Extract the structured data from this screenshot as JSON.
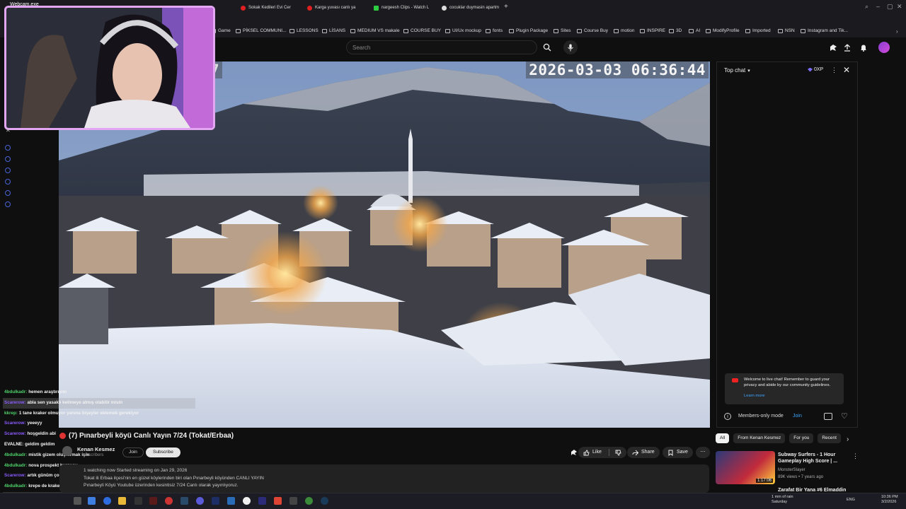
{
  "browser": {
    "tabs": [
      {
        "label": "Sokak Kedileri Evi Cer",
        "icon": "youtube-icon"
      },
      {
        "label": "Karga yuvası canlı ya",
        "icon": "youtube-icon"
      },
      {
        "label": "nargeesh Clips - Watch L",
        "icon": "kick-icon"
      },
      {
        "label": "cocuklar duymasin apartm",
        "icon": "globe-icon"
      }
    ],
    "bookmarks": [
      "Game",
      "PİKSEL COMMUNI...",
      "LESSONS",
      "LİSANS",
      "MEDIUM VS makale",
      "COURSE BUY",
      "UI/Ux mockup",
      "fonts",
      "Plugin Package",
      "Sites",
      "Course Buy",
      "motion",
      "INSPIRE",
      "3D",
      "AI",
      "ModifyProfile",
      "Imported",
      "NSN",
      "Instagram and Tik..."
    ]
  },
  "youtube": {
    "search_placeholder": "Search",
    "player": {
      "timestamp": "2026-03-03 06:36:44",
      "timestamp_left": "7"
    },
    "video": {
      "title": "(7) Pınarbeyli köyü Canlı Yayın 7/24 (Tokat/Erbaa)",
      "channel": "Kenan Kesmez",
      "subscribers": "... subscribers",
      "join": "Join",
      "subscribe": "Subscribe",
      "like": "Like",
      "share": "Share",
      "save": "Save",
      "desc_line1": "1 watching now  Started streaming on Jan 29, 2026",
      "desc_line2": "Tokat ili Erbaa ilçesi'nin en güzel köylerinden biri olan Pınarbeyli köyünden CANLI YAYIN",
      "desc_line3": "Pınarbeyli Köyü Youtube üzerinden kesintisiz 7/24 Canlı olarak yayınlıyoruz."
    },
    "live_chat": {
      "header": "Top chat",
      "xp": "0XP",
      "welcome": "Welcome to live chat! Remember to guard your privacy and abide by our community guidelines.",
      "learn_more": "Learn more",
      "members_only": "Members-only mode",
      "join": "Join"
    },
    "chips": [
      "All",
      "From Kenan Kesmez",
      "For you",
      "Recent"
    ],
    "recommendation": {
      "title": "Subway Surfers - 1 Hour Gameplay High Score | ...",
      "channel": "MonsterSlayer",
      "meta": "89K views • 7 years ago",
      "duration": "1:17:06",
      "next_title": "Zarafat Bir Yana #6 Elmaddin"
    }
  },
  "webcam": {
    "label": "Webcam.exe"
  },
  "stream_chat": [
    {
      "user": "4bdulkadr:",
      "msg": "hemen araştırıyım",
      "color": "#4fd36a",
      "hl": false
    },
    {
      "user": "Scarerow:",
      "msg": "abla sen yasaklı kelimeye almış olabilir misin",
      "color": "#8b5cff",
      "hl": true
    },
    {
      "user": "kkrep:",
      "msg": "1 tane kraker olmuyor yanına bişeyler eklemek gerekiyor",
      "color": "#4fd36a",
      "hl": false
    },
    {
      "user": "Scarerow:",
      "msg": "yeeeyy",
      "color": "#8b5cff",
      "hl": false
    },
    {
      "user": "Scarerow:",
      "msg": "hoşgeldin abi",
      "color": "#8b5cff",
      "hl": false
    },
    {
      "user": "EVALNE:",
      "msg": "geldim geldim",
      "color": "#ffffff",
      "hl": false
    },
    {
      "user": "4bdulkadr:",
      "msg": "mistik gizem oluşturmak için",
      "color": "#4fd36a",
      "hl": false
    },
    {
      "user": "4bdulkadr:",
      "msg": "nova prospekt kurgusu",
      "color": "#4fd36a",
      "hl": false
    },
    {
      "user": "Scarerow:",
      "msg": "artık günüm çok güzel geçecek",
      "color": "#8b5cff",
      "hl": false
    },
    {
      "user": "4bdulkadr:",
      "msg": "krepe de kraker yaz demiş yayına ijalip",
      "color": "#4fd36a",
      "hl": false
    },
    {
      "user": "Scarerow:",
      "msg": "pump hairine bi biceps verir miyim",
      "color": "#8b5cff",
      "hl": true
    }
  ],
  "taskbar": {
    "weather": "1 mm of rain",
    "weather_day": "Saturday",
    "lang": "ENG",
    "time": "10:36 PM",
    "date": "3/2/2026"
  },
  "colors": {
    "accent_purple": "#e3a6f2",
    "link_blue": "#3ea6ff",
    "live_red": "#dd3333"
  }
}
